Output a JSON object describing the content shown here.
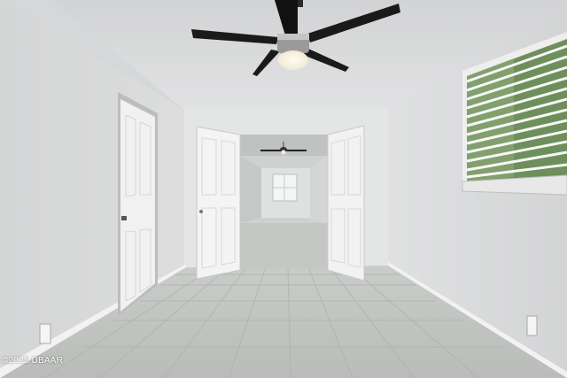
{
  "photo": {
    "watermark": "©2025 DBAAR"
  }
}
